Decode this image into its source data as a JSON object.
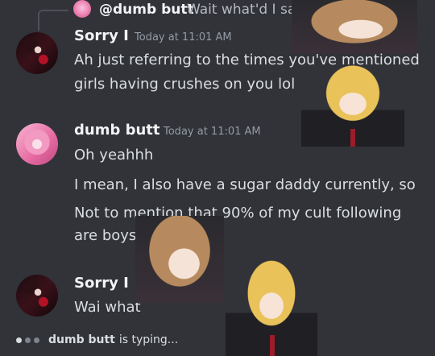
{
  "reply": {
    "author": "@dumb butt",
    "text": "Wait what'd I say"
  },
  "messages": [
    {
      "author": "Sorry I",
      "timestamp": "Today at 11:01 AM",
      "lines": [
        "Ah just referring to the times you've mentioned",
        "girls having crushes on you lol"
      ]
    },
    {
      "author": "dumb butt",
      "timestamp": "Today at 11:01 AM",
      "lines": [
        "Oh yeahhh",
        "I mean, I also have a sugar daddy currently, so",
        "Not to mention that 90% of my cult following",
        "are boys"
      ]
    },
    {
      "author": "Sorry I",
      "lines": [
        "Wai what"
      ]
    }
  ],
  "typing": {
    "name": "dumb butt",
    "text": "is typing..."
  },
  "colors": {
    "background": "#313338",
    "text": "#dbdee1",
    "muted": "#949ba4",
    "author": "#f2f3f5"
  },
  "icons": {
    "typing": "typing-dots-icon"
  }
}
